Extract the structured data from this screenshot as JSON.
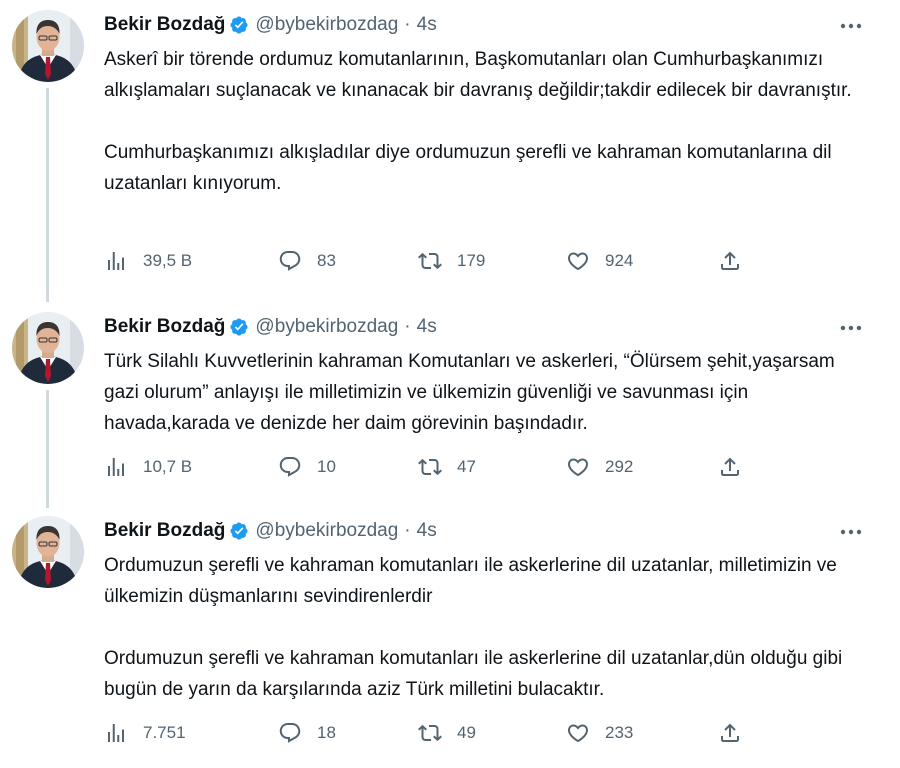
{
  "tweets": [
    {
      "author": {
        "name": "Bekir Bozdağ",
        "handle": "@bybekirbozdag",
        "separator": "·",
        "time": "4s"
      },
      "paragraphs": [
        "Askerî bir törende ordumuz komutanlarının, Başkomutanları olan Cumhurbaşkanımızı alkışlamaları suçlanacak ve kınanacak bir davranış değildir;takdir edilecek bir davranıştır.",
        "Cumhurbaşkanımızı alkışladılar diye ordumuzun şerefli ve kahraman komutanlarına dil uzatanları kınıyorum."
      ],
      "stats": {
        "views": "39,5 B",
        "replies": "83",
        "retweets": "179",
        "likes": "924"
      }
    },
    {
      "author": {
        "name": "Bekir Bozdağ",
        "handle": "@bybekirbozdag",
        "separator": "·",
        "time": "4s"
      },
      "paragraphs": [
        "Türk Silahlı Kuvvetlerinin kahraman Komutanları ve askerleri,  “Ölürsem şehit,yaşarsam gazi olurum” anlayışı ile milletimizin ve ülkemizin güvenliği ve savunması için havada,karada ve denizde her daim görevinin başındadır."
      ],
      "stats": {
        "views": "10,7 B",
        "replies": "10",
        "retweets": "47",
        "likes": "292"
      }
    },
    {
      "author": {
        "name": "Bekir Bozdağ",
        "handle": "@bybekirbozdag",
        "separator": "·",
        "time": "4s"
      },
      "paragraphs": [
        "Ordumuzun şerefli ve kahraman komutanları ile askerlerine dil uzatanlar, milletimizin ve ülkemizin düşmanlarını sevindirenlerdir",
        "Ordumuzun şerefli ve kahraman komutanları ile askerlerine dil uzatanlar,dün olduğu gibi bugün de yarın da karşılarında aziz Türk milletini bulacaktır."
      ],
      "stats": {
        "views": "7.751",
        "replies": "18",
        "retweets": "49",
        "likes": "233"
      }
    }
  ],
  "icons": {
    "verified": "verified-badge-icon",
    "more": "more-options-icon",
    "views": "analytics-icon",
    "reply": "reply-icon",
    "retweet": "retweet-icon",
    "like": "heart-icon",
    "share": "share-icon"
  },
  "colors": {
    "text": "#0f1419",
    "secondary": "#536471",
    "verified": "#1d9bf0",
    "thread_line": "#cfd9de"
  }
}
